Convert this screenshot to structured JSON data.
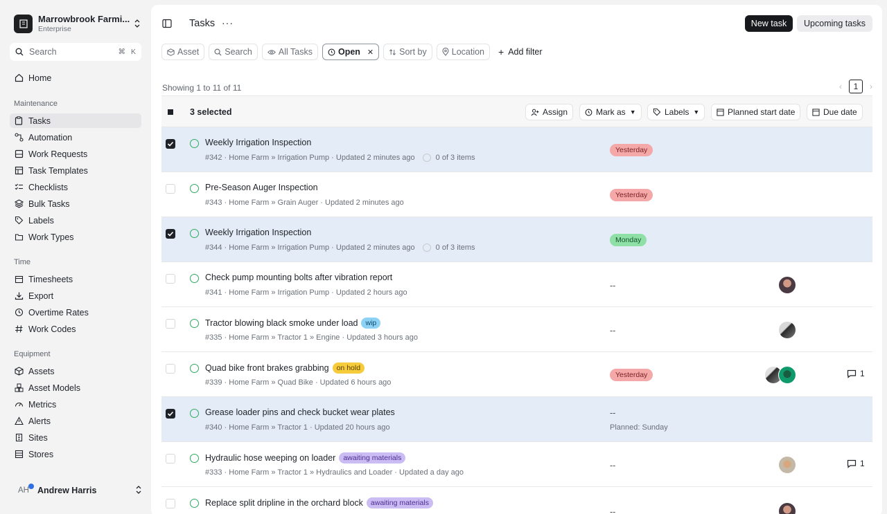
{
  "org": {
    "name": "Marrowbrook Farmi...",
    "plan": "Enterprise"
  },
  "search": {
    "label": "Search",
    "shortcut_mod": "⌘",
    "shortcut_key": "K"
  },
  "nav": {
    "home": "Home",
    "maintenance_label": "Maintenance",
    "maintenance": [
      "Tasks",
      "Automation",
      "Work Requests",
      "Task Templates",
      "Checklists",
      "Bulk Tasks",
      "Labels",
      "Work Types"
    ],
    "time_label": "Time",
    "time": [
      "Timesheets",
      "Export",
      "Overtime Rates",
      "Work Codes"
    ],
    "equipment_label": "Equipment",
    "equipment": [
      "Assets",
      "Asset Models",
      "Metrics",
      "Alerts",
      "Sites",
      "Stores"
    ]
  },
  "user": {
    "initials": "AH",
    "name": "Andrew Harris"
  },
  "header": {
    "title": "Tasks",
    "new_task": "New task",
    "upcoming": "Upcoming tasks"
  },
  "filters": {
    "asset": "Asset",
    "search": "Search",
    "all_tasks": "All Tasks",
    "open": "Open",
    "sort_by": "Sort by",
    "location": "Location",
    "add_filter": "Add filter"
  },
  "list": {
    "showing": "Showing 1 to 11 of 11",
    "page": "1"
  },
  "bulk": {
    "selected": "3 selected",
    "assign": "Assign",
    "mark_as": "Mark as",
    "labels": "Labels",
    "planned_start": "Planned start date",
    "due_date": "Due date"
  },
  "rows": [
    {
      "title": "Weekly Irrigation Inspection",
      "meta": "#342 · Home Farm » Irrigation Pump · Updated 2 minutes ago",
      "items": "0 of 3 items",
      "due": "Yesterday"
    },
    {
      "title": "Pre-Season Auger Inspection",
      "meta": "#343 · Home Farm » Grain Auger · Updated 2 minutes ago",
      "due": "Yesterday"
    },
    {
      "title": "Weekly Irrigation Inspection",
      "meta": "#344 · Home Farm » Irrigation Pump · Updated 2 minutes ago",
      "items": "0 of 3 items",
      "due": "Monday"
    },
    {
      "title": "Check pump mounting bolts after vibration report",
      "meta": "#341 · Home Farm » Irrigation Pump · Updated 2 hours ago",
      "due": "--"
    },
    {
      "title": "Tractor blowing black smoke under load",
      "tag": "wip",
      "meta": "#335 · Home Farm » Tractor 1 » Engine · Updated 3 hours ago",
      "due": "--"
    },
    {
      "title": "Quad bike front brakes grabbing",
      "tag": "on hold",
      "meta": "#339 · Home Farm » Quad Bike · Updated 6 hours ago",
      "due": "Yesterday",
      "comments": "1"
    },
    {
      "title": "Grease loader pins and check bucket wear plates",
      "meta": "#340 · Home Farm » Tractor 1 · Updated 20 hours ago",
      "due": "--",
      "planned": "Planned: Sunday"
    },
    {
      "title": "Hydraulic hose weeping on loader",
      "tag": "awaiting materials",
      "meta": "#333 · Home Farm » Tractor 1 » Hydraulics and Loader · Updated a day ago",
      "due": "--",
      "comments": "1"
    },
    {
      "title": "Replace split dripline in the orchard block",
      "tag": "awaiting materials",
      "meta": "",
      "due": "--"
    }
  ],
  "colors": {
    "accent_dark": "#17191c",
    "status_green": "#2faa5f",
    "selected_row": "#e4ecf7",
    "notification_dot": "#2f6fe4"
  }
}
